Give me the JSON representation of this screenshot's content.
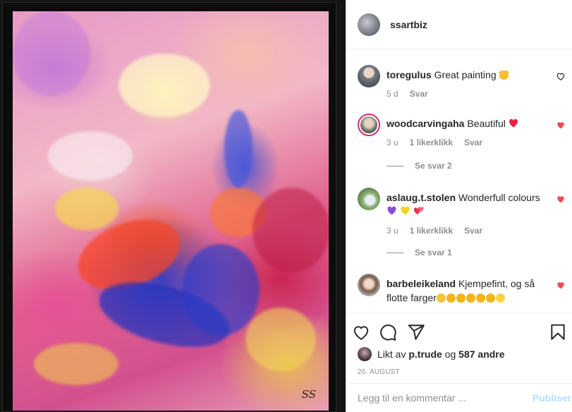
{
  "post": {
    "username": "ssartbiz",
    "painting_signature": "SS",
    "likes_label": "Likt av",
    "liked_by_user": "p.trude",
    "liked_and": "og",
    "liked_others": "587 andre",
    "date": "26. AUGUST",
    "comment_placeholder": "Legg til en kommentar ...",
    "publish_label": "Publiser"
  },
  "comments": [
    {
      "username": "toregulus",
      "text": "Great painting",
      "emojis": [
        "thumbs-up"
      ],
      "time": "5 d",
      "likes": "",
      "reply_label": "Svar",
      "liked": false,
      "view_replies": ""
    },
    {
      "username": "woodcarvingaha",
      "text": "Beautiful",
      "emojis": [
        "red-heart"
      ],
      "time": "3 u",
      "likes": "1 likerklikk",
      "reply_label": "Svar",
      "liked": true,
      "view_replies": "Se svar 2"
    },
    {
      "username": "aslaug.t.stolen",
      "text": "Wonderfull colours",
      "emojis": [
        "purple-heart",
        "yellow-heart",
        "two-hearts"
      ],
      "time": "3 u",
      "likes": "1 likerklikk",
      "reply_label": "Svar",
      "liked": true,
      "view_replies": "Se svar 1"
    },
    {
      "username": "barbeleikeland",
      "text": "Kjempefint, og så flotte farger",
      "emojis": [
        "ok-hand",
        "clapping-hands",
        "clapping-hands",
        "clapping-hands",
        "clapping-hands",
        "clapping-hands",
        "smiling-face"
      ],
      "time": "",
      "likes": "",
      "reply_label": "",
      "liked": true,
      "view_replies": ""
    }
  ],
  "colors": {
    "liked_heart": "#ed4956",
    "publish_disabled": "#b2dffc",
    "meta_gray": "#8e8e8e"
  }
}
